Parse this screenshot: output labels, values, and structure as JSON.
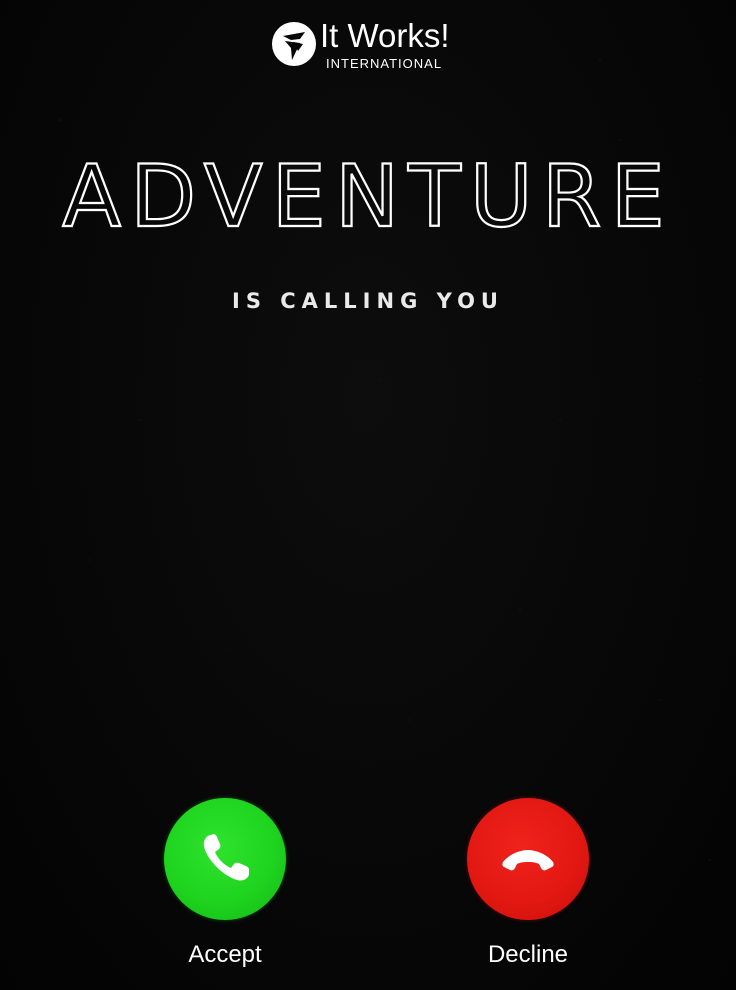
{
  "logo": {
    "title": "It Works!",
    "subtitle": "INTERNATIONAL",
    "mark_icon": "it-works-logo-icon"
  },
  "headline": {
    "text": "ADVENTURE",
    "subtext": "IS CALLING YOU"
  },
  "call": {
    "accept": {
      "label": "Accept",
      "icon": "phone-answer-icon",
      "color": "#22d622"
    },
    "decline": {
      "label": "Decline",
      "icon": "phone-hangup-icon",
      "color": "#e31a14"
    }
  },
  "colors": {
    "background": "#060606",
    "text": "#ffffff"
  }
}
